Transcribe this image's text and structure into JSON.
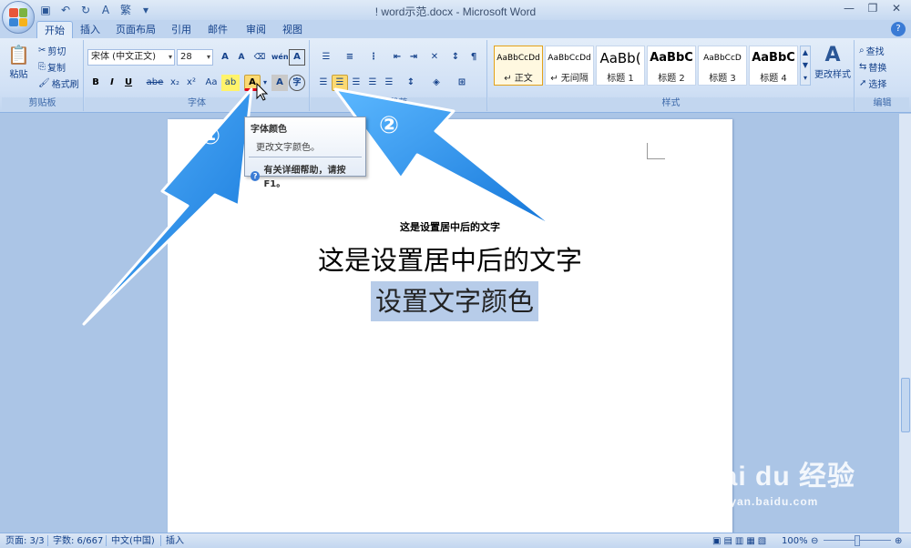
{
  "window": {
    "title": "! word示范.docx - Microsoft Word",
    "qat_icons": [
      "save-icon",
      "undo-icon",
      "redo-icon",
      "spelling-icon",
      "traditional-chinese-icon"
    ],
    "qat_trad": "繁"
  },
  "tabs": [
    {
      "label": "开始",
      "active": true
    },
    {
      "label": "插入"
    },
    {
      "label": "页面布局"
    },
    {
      "label": "引用"
    },
    {
      "label": "邮件"
    },
    {
      "label": "审阅"
    },
    {
      "label": "视图"
    }
  ],
  "clipboard": {
    "group_label": "剪贴板",
    "paste": "粘贴",
    "cut": "剪切",
    "copy": "复制",
    "format_painter": "格式刷"
  },
  "font": {
    "group_label": "字体",
    "font_name": "宋体 (中文正文)",
    "font_size": "28",
    "grow": "A",
    "shrink": "A",
    "clear": "",
    "phonetic": "wén",
    "border_char": "A",
    "bold": "B",
    "italic": "I",
    "underline": "U",
    "strike": "abe",
    "subscript": "x₂",
    "superscript": "x²",
    "change_case": "Aa",
    "highlight": "ab",
    "font_color": "A",
    "char_shading": "A",
    "enclose": "字"
  },
  "paragraph": {
    "group_label": "段落"
  },
  "styles": {
    "group_label": "样式",
    "items": [
      {
        "sample": "AaBbCcDd",
        "name": "↵ 正文",
        "selected": true
      },
      {
        "sample": "AaBbCcDd",
        "name": "↵ 无间隔"
      },
      {
        "sample": "AaBb(",
        "name": "标题 1"
      },
      {
        "sample": "AaBbC",
        "name": "标题 2"
      },
      {
        "sample": "AaBbCcD",
        "name": "标题 3"
      },
      {
        "sample": "AaBbC",
        "name": "标题 4"
      }
    ],
    "change_styles": "更改样式"
  },
  "editing": {
    "group_label": "编辑",
    "find": "查找",
    "replace": "替换",
    "select": "选择"
  },
  "tooltip": {
    "title": "字体颜色",
    "description": "更改文字颜色。",
    "help": "有关详细帮助，请按 F1。"
  },
  "document": {
    "line_small": "这是设置居中后的文字",
    "line_big": "这是设置居中后的文字",
    "line_selected": "设置文字颜色"
  },
  "annotations": {
    "marker1": "①",
    "marker2": "②",
    "arrow_color": "#1a8cf0"
  },
  "statusbar": {
    "page": "页面: 3/3",
    "words": "字数: 6/667",
    "language": "中文(中国)",
    "mode": "插入",
    "zoom": "100%"
  },
  "watermark": {
    "brand": "Bai  du 经验",
    "url": "jingyan.baidu.com"
  }
}
